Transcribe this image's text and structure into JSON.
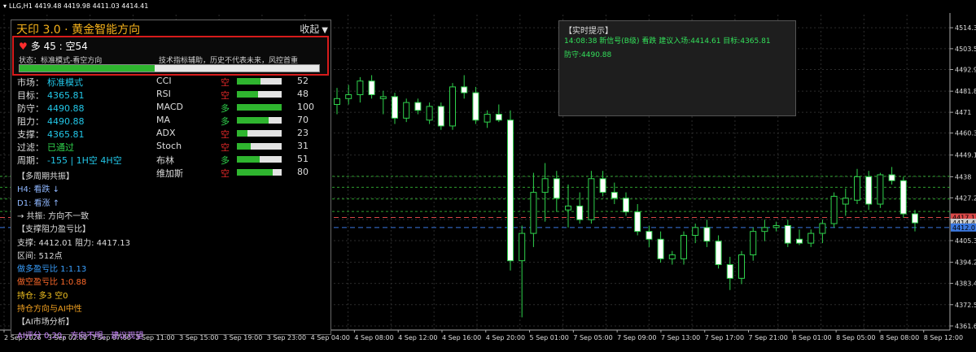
{
  "window": {
    "symbol_header": "LLG,H1  4419.48 4419.98 4411.03 4414.41"
  },
  "panel": {
    "title": "天印 3.0 · 黄金智能方向",
    "collapse_label": "收起",
    "direction": "多 45 : 空54",
    "mode_text": "状态：标准模式-看空方向",
    "disclaimer": "技术指标辅助，历史不代表未来，风控首重",
    "long_ratio": 0.45,
    "metrics": [
      {
        "label": "市场：",
        "value": "标准模式",
        "color": "#22c7e8"
      },
      {
        "label": "目标：",
        "value": "4365.81",
        "color": "#22c7e8"
      },
      {
        "label": "防守：",
        "value": "4490.88",
        "color": "#22c7e8"
      },
      {
        "label": "阻力：",
        "value": "4490.88",
        "color": "#22c7e8"
      },
      {
        "label": "支撑：",
        "value": "4365.81",
        "color": "#22c7e8"
      },
      {
        "label": "过滤：",
        "value": "已通过",
        "color": "#2fd24c"
      },
      {
        "label": "周期：",
        "value": "-155 | 1H空 4H空",
        "color": "#22c7e8"
      }
    ],
    "indicators": [
      {
        "name": "CCI",
        "signal": "空",
        "signal_color": "#e02828",
        "score": 52
      },
      {
        "name": "RSI",
        "signal": "空",
        "signal_color": "#e02828",
        "score": 48
      },
      {
        "name": "MACD",
        "signal": "多",
        "signal_color": "#2fd24c",
        "score": 100
      },
      {
        "name": "MA",
        "signal": "多",
        "signal_color": "#2fd24c",
        "score": 70
      },
      {
        "name": "ADX",
        "signal": "空",
        "signal_color": "#e02828",
        "score": 23
      },
      {
        "name": "Stoch",
        "signal": "空",
        "signal_color": "#e02828",
        "score": 31
      },
      {
        "name": "布林",
        "signal": "多",
        "signal_color": "#2fd24c",
        "score": 51
      },
      {
        "name": "维加斯",
        "signal": "空",
        "signal_color": "#e02828",
        "score": 80
      }
    ],
    "sections": [
      {
        "text": "【多周期共振】",
        "color": "#dddddd"
      },
      {
        "text": "H4: 看跌 ↓",
        "color": "#8fb7ff"
      },
      {
        "text": "D1: 看涨 ↑",
        "color": "#8fb7ff"
      },
      {
        "text": "→ 共振: 方向不一致",
        "color": "#dddddd"
      },
      {
        "text": "【支撑阻力盈亏比】",
        "color": "#dddddd"
      },
      {
        "text": "支撑: 4412.01 阻力: 4417.13",
        "color": "#dddddd"
      },
      {
        "text": "区间: 512点",
        "color": "#dddddd"
      },
      {
        "text": "做多盈亏比 1:1.13",
        "color": "#3aa0ff"
      },
      {
        "text": "做空盈亏比 1:0.88",
        "color": "#ff6a2a"
      },
      {
        "text": "持仓: 多3 空0",
        "color": "#f0c020"
      },
      {
        "text": "持仓方向与AI中性",
        "color": "#f0a020"
      },
      {
        "text": "【AI市场分析】",
        "color": "#dddddd"
      },
      {
        "text": "AI评分 0.20，方向不明，建议观望",
        "color": "#cc88ff"
      }
    ]
  },
  "alert": {
    "title": "【实时提示】",
    "line1": "14:08:38 新信号(B级) 看跌 建议入场:4414.61 目标:4365.81",
    "line2": "防守:4490.88"
  },
  "chart_data": {
    "type": "candlestick",
    "title": "",
    "y_ticks": [
      4514.3,
      4503.56,
      4492.9,
      4481.8,
      4471.0,
      4460.36,
      4449.1,
      4438.0,
      4427.2,
      4416.1,
      4405.3,
      4394.2,
      4383.4,
      4372.5,
      4361.6
    ],
    "x_ticks": [
      "2 Sep 2026",
      "3 Sep 02:00",
      "3 Sep 07:00",
      "3 Sep 11:00",
      "3 Sep 15:00",
      "3 Sep 19:00",
      "3 Sep 23:00",
      "4 Sep 04:00",
      "4 Sep 08:00",
      "4 Sep 12:00",
      "4 Sep 16:00",
      "4 Sep 20:00",
      "5 Sep 01:00",
      "7 Sep 05:00",
      "7 Sep 09:00",
      "7 Sep 13:00",
      "7 Sep 17:00",
      "7 Sep 21:00",
      "8 Sep 01:00",
      "8 Sep 05:00",
      "8 Sep 08:00",
      "8 Sep 12:00"
    ],
    "ylim": [
      4359.5,
      4521.0
    ],
    "price_labels": [
      {
        "value": "4417.13",
        "color": "#d94848"
      },
      {
        "value": "4414.41",
        "color": "#cccccc"
      },
      {
        "value": "4412.01",
        "color": "#3b78e0"
      }
    ],
    "hlines": [
      {
        "value": 4417.13,
        "color": "#d94848",
        "dash": "6,4"
      },
      {
        "value": 4412.01,
        "color": "#3b78e0",
        "dash": "6,4"
      },
      {
        "value": 4438.2,
        "color": "#2e9e2e",
        "dash": "3,3"
      },
      {
        "value": 4432.6,
        "color": "#2e9e2e",
        "dash": "3,3"
      },
      {
        "value": 4426.6,
        "color": "#2e9e2e",
        "dash": "3,3"
      },
      {
        "value": 4420.2,
        "color": "#2e9e2e",
        "dash": "3,3"
      }
    ],
    "candles": [
      {
        "o": 4475.0,
        "h": 4483.5,
        "l": 4470.0,
        "c": 4478.0
      },
      {
        "o": 4478.0,
        "h": 4485.0,
        "l": 4475.0,
        "c": 4480.0
      },
      {
        "o": 4480.0,
        "h": 4489.0,
        "l": 4476.0,
        "c": 4487.0
      },
      {
        "o": 4487.0,
        "h": 4490.0,
        "l": 4478.0,
        "c": 4480.0
      },
      {
        "o": 4478.0,
        "h": 4482.0,
        "l": 4470.0,
        "c": 4479.0
      },
      {
        "o": 4479.0,
        "h": 4481.0,
        "l": 4465.0,
        "c": 4468.0
      },
      {
        "o": 4468.0,
        "h": 4478.0,
        "l": 4466.0,
        "c": 4476.0
      },
      {
        "o": 4476.0,
        "h": 4478.0,
        "l": 4470.0,
        "c": 4472.0
      },
      {
        "o": 4467.0,
        "h": 4476.0,
        "l": 4465.0,
        "c": 4474.0
      },
      {
        "o": 4474.0,
        "h": 4476.0,
        "l": 4462.0,
        "c": 4464.0
      },
      {
        "o": 4464.0,
        "h": 4486.0,
        "l": 4462.0,
        "c": 4484.0
      },
      {
        "o": 4484.0,
        "h": 4490.0,
        "l": 4478.0,
        "c": 4481.0
      },
      {
        "o": 4481.0,
        "h": 4484.0,
        "l": 4465.0,
        "c": 4467.0
      },
      {
        "o": 4466.0,
        "h": 4472.0,
        "l": 4463.0,
        "c": 4470.0
      },
      {
        "o": 4470.0,
        "h": 4475.0,
        "l": 4466.0,
        "c": 4467.0
      },
      {
        "o": 4467.0,
        "h": 4472.0,
        "l": 4390.0,
        "c": 4395.0
      },
      {
        "o": 4395.0,
        "h": 4413.0,
        "l": 4366.0,
        "c": 4409.0
      },
      {
        "o": 4409.0,
        "h": 4440.0,
        "l": 4402.0,
        "c": 4430.0
      },
      {
        "o": 4430.0,
        "h": 4445.0,
        "l": 4415.0,
        "c": 4437.0
      },
      {
        "o": 4437.0,
        "h": 4441.0,
        "l": 4420.0,
        "c": 4427.0
      },
      {
        "o": 4421.0,
        "h": 4434.0,
        "l": 4412.0,
        "c": 4423.0
      },
      {
        "o": 4423.0,
        "h": 4430.0,
        "l": 4414.0,
        "c": 4416.0
      },
      {
        "o": 4416.0,
        "h": 4441.0,
        "l": 4414.0,
        "c": 4437.0
      },
      {
        "o": 4437.0,
        "h": 4441.0,
        "l": 4428.0,
        "c": 4430.0
      },
      {
        "o": 4430.0,
        "h": 4435.0,
        "l": 4424.0,
        "c": 4427.0
      },
      {
        "o": 4427.0,
        "h": 4430.0,
        "l": 4418.0,
        "c": 4420.0
      },
      {
        "o": 4420.0,
        "h": 4424.0,
        "l": 4408.0,
        "c": 4410.0
      },
      {
        "o": 4410.0,
        "h": 4413.0,
        "l": 4402.0,
        "c": 4406.0
      },
      {
        "o": 4406.0,
        "h": 4410.0,
        "l": 4394.0,
        "c": 4396.0
      },
      {
        "o": 4396.0,
        "h": 4400.0,
        "l": 4393.0,
        "c": 4398.0
      },
      {
        "o": 4396.0,
        "h": 4410.0,
        "l": 4393.0,
        "c": 4408.0
      },
      {
        "o": 4408.0,
        "h": 4414.0,
        "l": 4404.0,
        "c": 4412.0
      },
      {
        "o": 4412.0,
        "h": 4416.0,
        "l": 4402.0,
        "c": 4405.0
      },
      {
        "o": 4405.0,
        "h": 4408.0,
        "l": 4391.0,
        "c": 4393.0
      },
      {
        "o": 4393.0,
        "h": 4397.0,
        "l": 4380.0,
        "c": 4386.0
      },
      {
        "o": 4386.0,
        "h": 4400.0,
        "l": 4383.0,
        "c": 4398.0
      },
      {
        "o": 4398.0,
        "h": 4412.0,
        "l": 4395.0,
        "c": 4410.0
      },
      {
        "o": 4410.0,
        "h": 4416.0,
        "l": 4405.0,
        "c": 4412.0
      },
      {
        "o": 4412.0,
        "h": 4415.0,
        "l": 4410.0,
        "c": 4413.0
      },
      {
        "o": 4413.0,
        "h": 4416.0,
        "l": 4402.0,
        "c": 4404.0
      },
      {
        "o": 4406.0,
        "h": 4411.0,
        "l": 4403.0,
        "c": 4404.0
      },
      {
        "o": 4404.0,
        "h": 4411.0,
        "l": 4402.0,
        "c": 4409.0
      },
      {
        "o": 4409.0,
        "h": 4416.0,
        "l": 4404.0,
        "c": 4414.0
      },
      {
        "o": 4414.0,
        "h": 4430.0,
        "l": 4412.0,
        "c": 4428.0
      },
      {
        "o": 4424.0,
        "h": 4432.0,
        "l": 4418.0,
        "c": 4427.0
      },
      {
        "o": 4426.0,
        "h": 4442.0,
        "l": 4424.0,
        "c": 4438.0
      },
      {
        "o": 4438.0,
        "h": 4441.0,
        "l": 4421.0,
        "c": 4424.0
      },
      {
        "o": 4424.0,
        "h": 4440.0,
        "l": 4422.0,
        "c": 4439.0
      },
      {
        "o": 4439.0,
        "h": 4443.0,
        "l": 4434.0,
        "c": 4436.0
      },
      {
        "o": 4436.0,
        "h": 4438.0,
        "l": 4417.0,
        "c": 4419.0
      },
      {
        "o": 4419.0,
        "h": 4421.0,
        "l": 4410.0,
        "c": 4414.4
      }
    ]
  }
}
